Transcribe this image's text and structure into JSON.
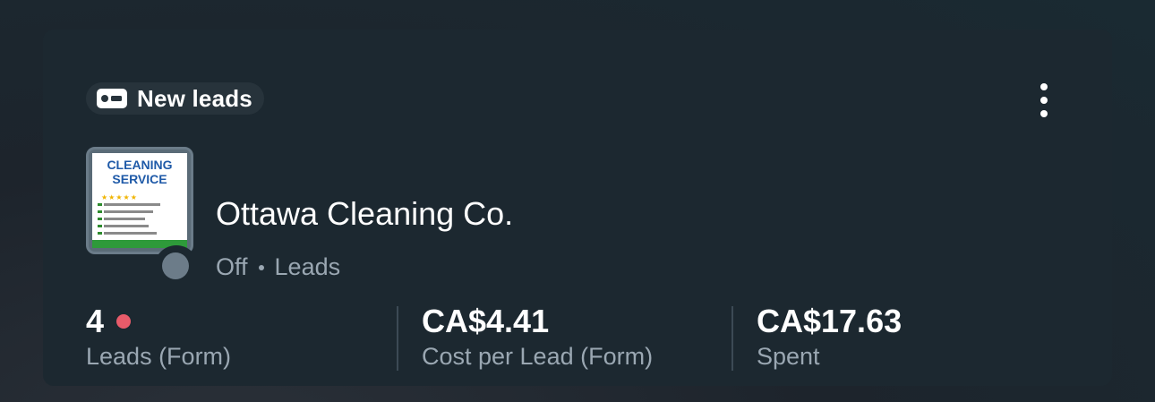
{
  "badge": {
    "label": "New leads",
    "icon": "lead-form-icon"
  },
  "menu": {
    "icon": "more-vertical-icon"
  },
  "campaign": {
    "name": "Ottawa Cleaning Co.",
    "status": "Off",
    "objective": "Leads",
    "thumbnail": {
      "title": "CLEANING\nSERVICE",
      "stars": "★★★★★"
    }
  },
  "metrics": [
    {
      "value": "4",
      "label": "Leads (Form)",
      "has_alert": true
    },
    {
      "value": "CA$4.41",
      "label": "Cost per Lead (Form)"
    },
    {
      "value": "CA$17.63",
      "label": "Spent"
    }
  ],
  "colors": {
    "card_bg": "#1c2830",
    "badge_bg": "#27333b",
    "muted_text": "#9aa7b2",
    "alert_dot": "#e85b6a",
    "status_off": "#6c7c89"
  }
}
